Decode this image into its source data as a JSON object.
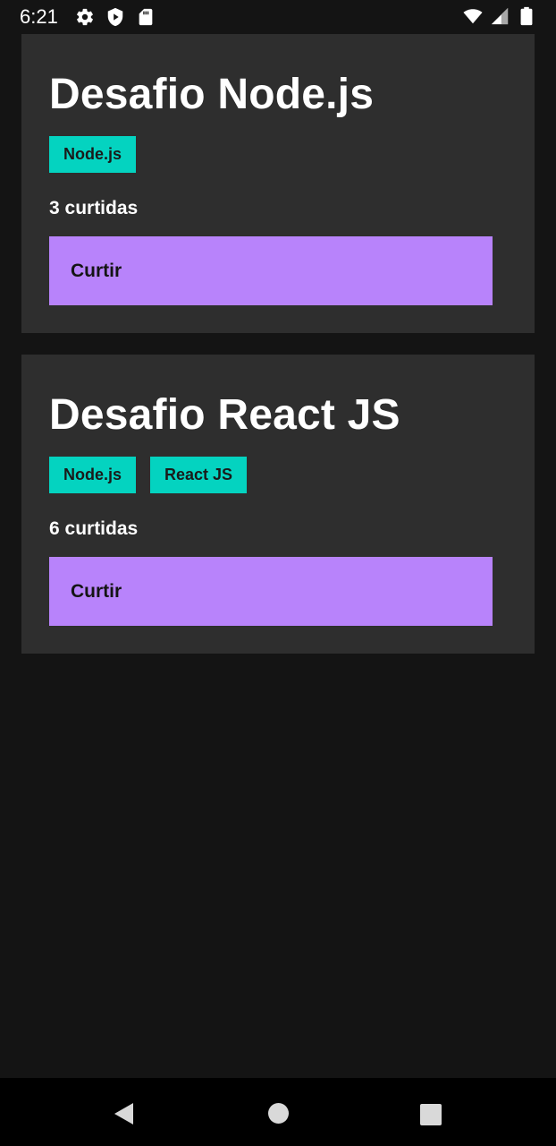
{
  "status_bar": {
    "time": "6:21",
    "left_icons": [
      "gear-icon",
      "shield-icon",
      "sd-card-icon"
    ],
    "right_icons": [
      "wifi-icon",
      "signal-icon",
      "battery-icon"
    ]
  },
  "repositories": [
    {
      "title": "Desafio Node.js",
      "techs": [
        "Node.js"
      ],
      "likes_text": "3 curtidas",
      "like_button": "Curtir"
    },
    {
      "title": "Desafio React JS",
      "techs": [
        "Node.js",
        "React JS"
      ],
      "likes_text": "6 curtidas",
      "like_button": "Curtir"
    }
  ],
  "nav_bar": {
    "icons": [
      "back-icon",
      "home-icon",
      "recents-icon"
    ]
  },
  "colors": {
    "background": "#141414",
    "card": "#2e2e2e",
    "badge": "#04d3c0",
    "button": "#b883fb"
  }
}
